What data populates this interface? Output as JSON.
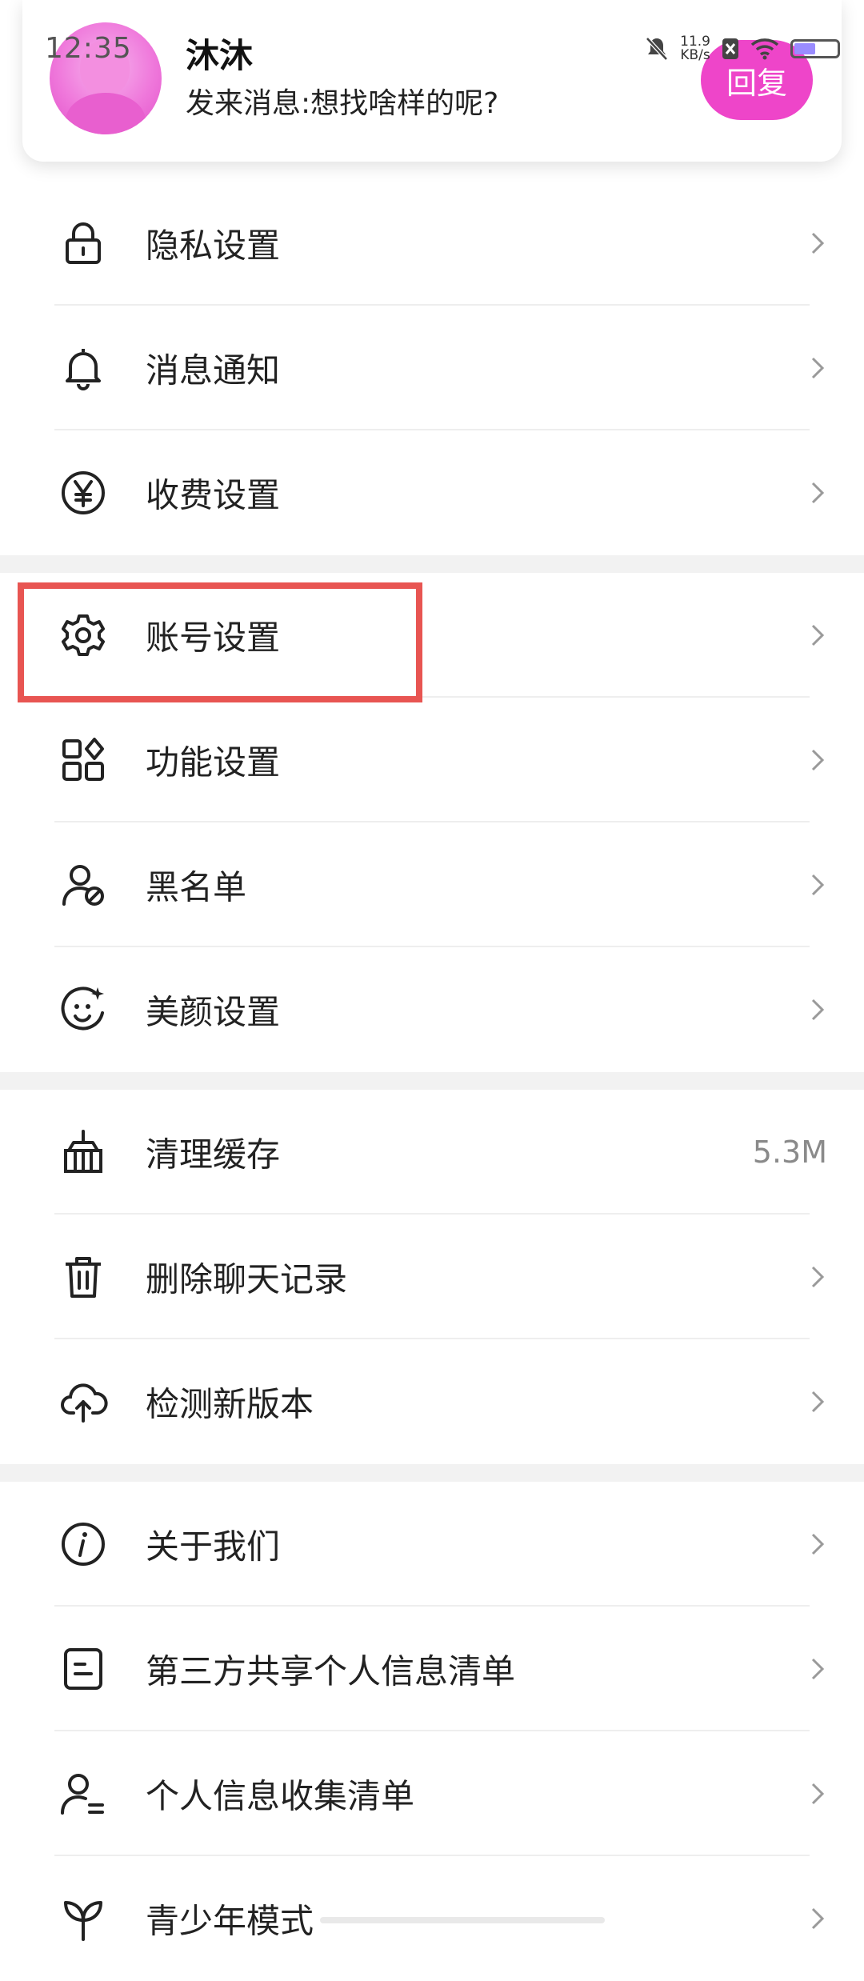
{
  "status_bar": {
    "time": "12:35",
    "speed_value": "11.9",
    "speed_unit": "KB/s"
  },
  "notification": {
    "sender": "沐沐",
    "message": "发来消息:想找啥样的呢?",
    "reply_label": "回复"
  },
  "settings": {
    "privacy": "隐私设置",
    "notifications": "消息通知",
    "charging": "收费设置",
    "account": "账号设置",
    "features": "功能设置",
    "blacklist": "黑名单",
    "beauty": "美颜设置",
    "clear_cache": "清理缓存",
    "cache_size": "5.3M",
    "delete_chat": "删除聊天记录",
    "check_update": "检测新版本",
    "about": "关于我们",
    "third_party": "第三方共享个人信息清单",
    "personal_info": "个人信息收集清单",
    "teen_mode": "青少年模式"
  },
  "colors": {
    "accent": "#ee45c9",
    "highlight": "#e85552",
    "divider": "#eeeeee"
  }
}
